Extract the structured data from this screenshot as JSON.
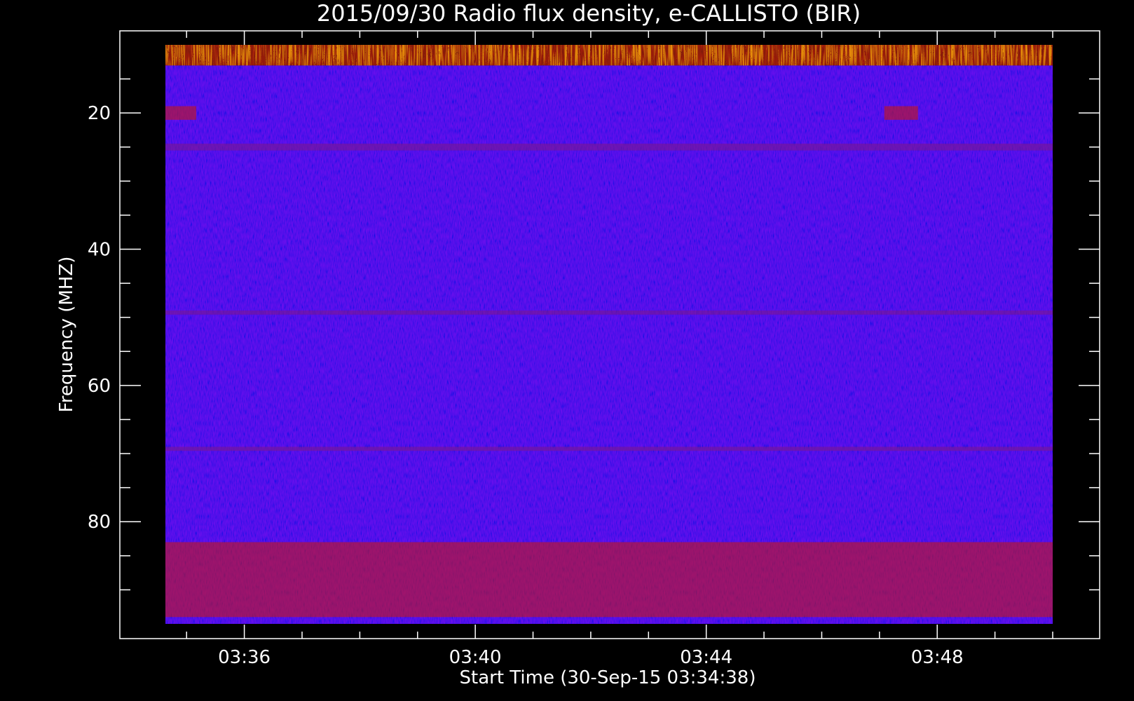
{
  "chart_data": {
    "type": "heatmap",
    "title": "2015/09/30  Radio flux density, e-CALLISTO (BIR)",
    "xlabel": "Start Time (30-Sep-15 03:34:38)",
    "ylabel": "Frequency (MHZ)",
    "x_start": "03:34:38",
    "x_end": "03:50:00",
    "x_ticks": [
      "03:36",
      "03:40",
      "03:44",
      "03:48"
    ],
    "x_tick_minutes": [
      36,
      40,
      44,
      48
    ],
    "y_ticks": [
      "20",
      "40",
      "60",
      "80"
    ],
    "y_tick_values": [
      20,
      40,
      60,
      80
    ],
    "ylim": [
      10,
      95
    ],
    "y_inverted": true,
    "grid": false,
    "colormap": [
      "#000000",
      "#1a00a8",
      "#2a1cff",
      "#7a1890",
      "#c41818",
      "#ff6a00",
      "#ffd400",
      "#ffffff"
    ],
    "background_color": "#2a1cff",
    "bright_bands": [
      {
        "freq_from": 10,
        "freq_to": 13,
        "intensity": "high",
        "from": "03:34:38",
        "to": "03:50:00"
      },
      {
        "freq_from": 19,
        "freq_to": 21,
        "intensity": "medium",
        "from": "03:34:38",
        "to": "03:35:10"
      },
      {
        "freq_from": 19,
        "freq_to": 21,
        "intensity": "medium",
        "from": "03:47:05",
        "to": "03:47:40"
      },
      {
        "freq_from": 24.5,
        "freq_to": 25.5,
        "intensity": "low",
        "from": "03:34:38",
        "to": "03:50:00"
      },
      {
        "freq_from": 49,
        "freq_to": 49.6,
        "intensity": "low",
        "from": "03:34:38",
        "to": "03:50:00"
      },
      {
        "freq_from": 69,
        "freq_to": 69.6,
        "intensity": "low",
        "from": "03:34:38",
        "to": "03:50:00"
      },
      {
        "freq_from": 83,
        "freq_to": 94,
        "intensity": "medium",
        "from": "03:34:38",
        "to": "03:50:00"
      }
    ]
  }
}
